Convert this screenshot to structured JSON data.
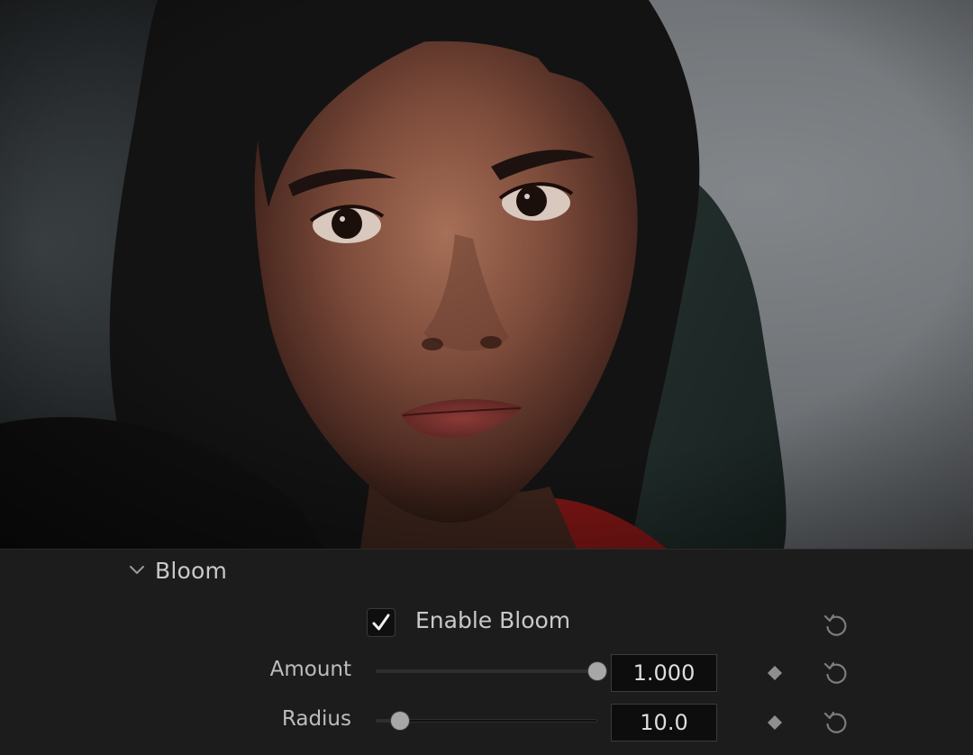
{
  "viewer": {
    "description_icon": "portrait-preview-image"
  },
  "section": {
    "title": "Bloom",
    "expanded": true,
    "chevron_icon": "chevron-down-icon"
  },
  "enable": {
    "label": "Enable Bloom",
    "checked": true,
    "reset_icon": "reset-icon"
  },
  "params": [
    {
      "label": "Amount",
      "value": "1.000",
      "slider_fraction": 1.0,
      "keyframe_icon": "keyframe-diamond-icon",
      "reset_icon": "reset-icon"
    },
    {
      "label": "Radius",
      "value": "10.0",
      "slider_fraction": 0.11,
      "keyframe_icon": "keyframe-diamond-icon",
      "reset_icon": "reset-icon"
    }
  ],
  "colors": {
    "panel_bg": "#1c1c1c",
    "text": "#c9c9c9",
    "knob": "#a7a7a7",
    "field_bg": "#0d0d0d"
  }
}
